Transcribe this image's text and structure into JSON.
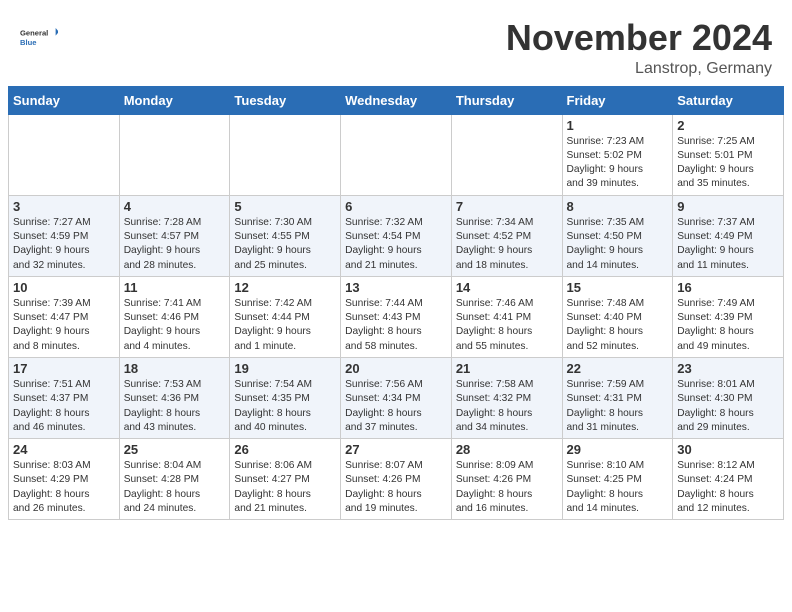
{
  "header": {
    "logo_general": "General",
    "logo_blue": "Blue",
    "title": "November 2024",
    "subtitle": "Lanstrop, Germany"
  },
  "days_of_week": [
    "Sunday",
    "Monday",
    "Tuesday",
    "Wednesday",
    "Thursday",
    "Friday",
    "Saturday"
  ],
  "weeks": [
    [
      {
        "day": "",
        "info": ""
      },
      {
        "day": "",
        "info": ""
      },
      {
        "day": "",
        "info": ""
      },
      {
        "day": "",
        "info": ""
      },
      {
        "day": "",
        "info": ""
      },
      {
        "day": "1",
        "info": "Sunrise: 7:23 AM\nSunset: 5:02 PM\nDaylight: 9 hours\nand 39 minutes."
      },
      {
        "day": "2",
        "info": "Sunrise: 7:25 AM\nSunset: 5:01 PM\nDaylight: 9 hours\nand 35 minutes."
      }
    ],
    [
      {
        "day": "3",
        "info": "Sunrise: 7:27 AM\nSunset: 4:59 PM\nDaylight: 9 hours\nand 32 minutes."
      },
      {
        "day": "4",
        "info": "Sunrise: 7:28 AM\nSunset: 4:57 PM\nDaylight: 9 hours\nand 28 minutes."
      },
      {
        "day": "5",
        "info": "Sunrise: 7:30 AM\nSunset: 4:55 PM\nDaylight: 9 hours\nand 25 minutes."
      },
      {
        "day": "6",
        "info": "Sunrise: 7:32 AM\nSunset: 4:54 PM\nDaylight: 9 hours\nand 21 minutes."
      },
      {
        "day": "7",
        "info": "Sunrise: 7:34 AM\nSunset: 4:52 PM\nDaylight: 9 hours\nand 18 minutes."
      },
      {
        "day": "8",
        "info": "Sunrise: 7:35 AM\nSunset: 4:50 PM\nDaylight: 9 hours\nand 14 minutes."
      },
      {
        "day": "9",
        "info": "Sunrise: 7:37 AM\nSunset: 4:49 PM\nDaylight: 9 hours\nand 11 minutes."
      }
    ],
    [
      {
        "day": "10",
        "info": "Sunrise: 7:39 AM\nSunset: 4:47 PM\nDaylight: 9 hours\nand 8 minutes."
      },
      {
        "day": "11",
        "info": "Sunrise: 7:41 AM\nSunset: 4:46 PM\nDaylight: 9 hours\nand 4 minutes."
      },
      {
        "day": "12",
        "info": "Sunrise: 7:42 AM\nSunset: 4:44 PM\nDaylight: 9 hours\nand 1 minute."
      },
      {
        "day": "13",
        "info": "Sunrise: 7:44 AM\nSunset: 4:43 PM\nDaylight: 8 hours\nand 58 minutes."
      },
      {
        "day": "14",
        "info": "Sunrise: 7:46 AM\nSunset: 4:41 PM\nDaylight: 8 hours\nand 55 minutes."
      },
      {
        "day": "15",
        "info": "Sunrise: 7:48 AM\nSunset: 4:40 PM\nDaylight: 8 hours\nand 52 minutes."
      },
      {
        "day": "16",
        "info": "Sunrise: 7:49 AM\nSunset: 4:39 PM\nDaylight: 8 hours\nand 49 minutes."
      }
    ],
    [
      {
        "day": "17",
        "info": "Sunrise: 7:51 AM\nSunset: 4:37 PM\nDaylight: 8 hours\nand 46 minutes."
      },
      {
        "day": "18",
        "info": "Sunrise: 7:53 AM\nSunset: 4:36 PM\nDaylight: 8 hours\nand 43 minutes."
      },
      {
        "day": "19",
        "info": "Sunrise: 7:54 AM\nSunset: 4:35 PM\nDaylight: 8 hours\nand 40 minutes."
      },
      {
        "day": "20",
        "info": "Sunrise: 7:56 AM\nSunset: 4:34 PM\nDaylight: 8 hours\nand 37 minutes."
      },
      {
        "day": "21",
        "info": "Sunrise: 7:58 AM\nSunset: 4:32 PM\nDaylight: 8 hours\nand 34 minutes."
      },
      {
        "day": "22",
        "info": "Sunrise: 7:59 AM\nSunset: 4:31 PM\nDaylight: 8 hours\nand 31 minutes."
      },
      {
        "day": "23",
        "info": "Sunrise: 8:01 AM\nSunset: 4:30 PM\nDaylight: 8 hours\nand 29 minutes."
      }
    ],
    [
      {
        "day": "24",
        "info": "Sunrise: 8:03 AM\nSunset: 4:29 PM\nDaylight: 8 hours\nand 26 minutes."
      },
      {
        "day": "25",
        "info": "Sunrise: 8:04 AM\nSunset: 4:28 PM\nDaylight: 8 hours\nand 24 minutes."
      },
      {
        "day": "26",
        "info": "Sunrise: 8:06 AM\nSunset: 4:27 PM\nDaylight: 8 hours\nand 21 minutes."
      },
      {
        "day": "27",
        "info": "Sunrise: 8:07 AM\nSunset: 4:26 PM\nDaylight: 8 hours\nand 19 minutes."
      },
      {
        "day": "28",
        "info": "Sunrise: 8:09 AM\nSunset: 4:26 PM\nDaylight: 8 hours\nand 16 minutes."
      },
      {
        "day": "29",
        "info": "Sunrise: 8:10 AM\nSunset: 4:25 PM\nDaylight: 8 hours\nand 14 minutes."
      },
      {
        "day": "30",
        "info": "Sunrise: 8:12 AM\nSunset: 4:24 PM\nDaylight: 8 hours\nand 12 minutes."
      }
    ]
  ]
}
